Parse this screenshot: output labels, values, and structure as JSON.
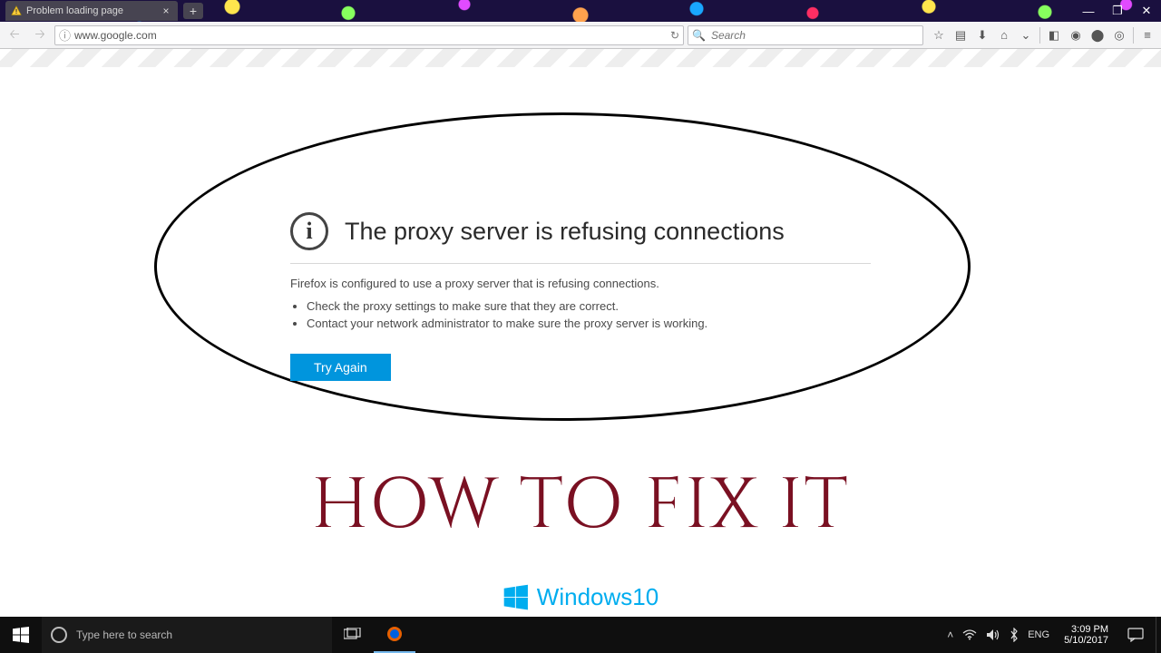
{
  "browser": {
    "tab_title": "Problem loading page",
    "url": "www.google.com",
    "search_placeholder": "Search"
  },
  "error": {
    "title": "The proxy server is refusing connections",
    "subtitle": "Firefox is configured to use a proxy server that is refusing connections.",
    "bullets": [
      "Check the proxy settings to make sure that they are correct.",
      "Contact your network administrator to make sure the proxy server is working."
    ],
    "try_again": "Try Again"
  },
  "annotation": {
    "howto": "HOW TO FIX IT",
    "win10_label": "Windows10"
  },
  "taskbar": {
    "search_placeholder": "Type here to search",
    "tray_lang": "ENG",
    "clock_time": "3:09 PM",
    "clock_date": "5/10/2017"
  }
}
